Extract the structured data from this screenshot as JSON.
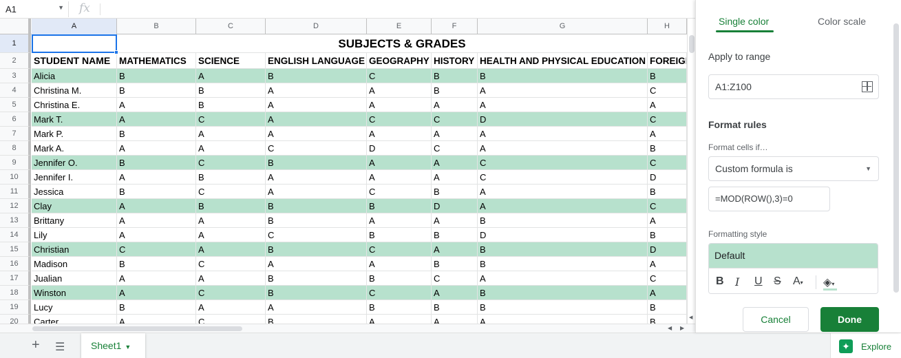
{
  "formula_bar": {
    "name_box": "A1",
    "fx": "fx"
  },
  "columns": [
    "A",
    "B",
    "C",
    "D",
    "E",
    "F",
    "G",
    "H"
  ],
  "title": "SUBJECTS & GRADES",
  "headers": [
    "STUDENT NAME",
    "MATHEMATICS",
    "SCIENCE",
    "ENGLISH LANGUAGE",
    "GEOGRAPHY",
    "HISTORY",
    "HEALTH AND PHYSICAL EDUCATION",
    "FOREIGN"
  ],
  "rows": [
    {
      "num": "1"
    },
    {
      "num": "2"
    },
    {
      "num": "3",
      "cells": [
        "Alicia",
        "B",
        "A",
        "B",
        "C",
        "B",
        "B",
        "B"
      ]
    },
    {
      "num": "4",
      "cells": [
        "Christina M.",
        "B",
        "B",
        "A",
        "A",
        "B",
        "A",
        "C"
      ]
    },
    {
      "num": "5",
      "cells": [
        "Christina E.",
        "A",
        "B",
        "A",
        "A",
        "A",
        "A",
        "A"
      ]
    },
    {
      "num": "6",
      "cells": [
        "Mark T.",
        "A",
        "C",
        "A",
        "C",
        "C",
        "D",
        "C"
      ]
    },
    {
      "num": "7",
      "cells": [
        "Mark P.",
        "B",
        "A",
        "A",
        "A",
        "A",
        "A",
        "A"
      ]
    },
    {
      "num": "8",
      "cells": [
        "Mark A.",
        "A",
        "A",
        "C",
        "D",
        "C",
        "A",
        "B"
      ]
    },
    {
      "num": "9",
      "cells": [
        "Jennifer O.",
        "B",
        "C",
        "B",
        "A",
        "A",
        "C",
        "C"
      ]
    },
    {
      "num": "10",
      "cells": [
        "Jennifer I.",
        "A",
        "B",
        "A",
        "A",
        "A",
        "C",
        "D"
      ]
    },
    {
      "num": "11",
      "cells": [
        "Jessica",
        "B",
        "C",
        "A",
        "C",
        "B",
        "A",
        "B"
      ]
    },
    {
      "num": "12",
      "cells": [
        "Clay",
        "A",
        "B",
        "B",
        "B",
        "D",
        "A",
        "C"
      ]
    },
    {
      "num": "13",
      "cells": [
        "Brittany",
        "A",
        "A",
        "B",
        "A",
        "A",
        "B",
        "A"
      ]
    },
    {
      "num": "14",
      "cells": [
        "Lily",
        "A",
        "A",
        "C",
        "B",
        "B",
        "D",
        "B"
      ]
    },
    {
      "num": "15",
      "cells": [
        "Christian",
        "C",
        "A",
        "B",
        "C",
        "A",
        "B",
        "D"
      ]
    },
    {
      "num": "16",
      "cells": [
        "Madison",
        "B",
        "C",
        "A",
        "A",
        "B",
        "B",
        "A"
      ]
    },
    {
      "num": "17",
      "cells": [
        "Jualian",
        "A",
        "A",
        "B",
        "B",
        "C",
        "A",
        "C"
      ]
    },
    {
      "num": "18",
      "cells": [
        "Winston",
        "A",
        "C",
        "B",
        "C",
        "A",
        "B",
        "A"
      ]
    },
    {
      "num": "19",
      "cells": [
        "Lucy",
        "B",
        "A",
        "A",
        "B",
        "B",
        "B",
        "B"
      ]
    },
    {
      "num": "20",
      "cells": [
        "Carter",
        "A",
        "C",
        "B",
        "A",
        "A",
        "A",
        "B"
      ]
    }
  ],
  "sheet_tab": "Sheet1",
  "explore": "Explore",
  "panel": {
    "tab_single": "Single color",
    "tab_scale": "Color scale",
    "apply_label": "Apply to range",
    "range_value": "A1:Z100",
    "format_rules": "Format rules",
    "format_cells_if": "Format cells if…",
    "condition": "Custom formula is",
    "formula": "=MOD(ROW(),3)=0",
    "formatting_style": "Formatting style",
    "style_preview": "Default",
    "cancel": "Cancel",
    "done": "Done"
  },
  "colors": {
    "accent": "#188038",
    "highlight": "#b7e1cd",
    "selection": "#1a73e8"
  }
}
